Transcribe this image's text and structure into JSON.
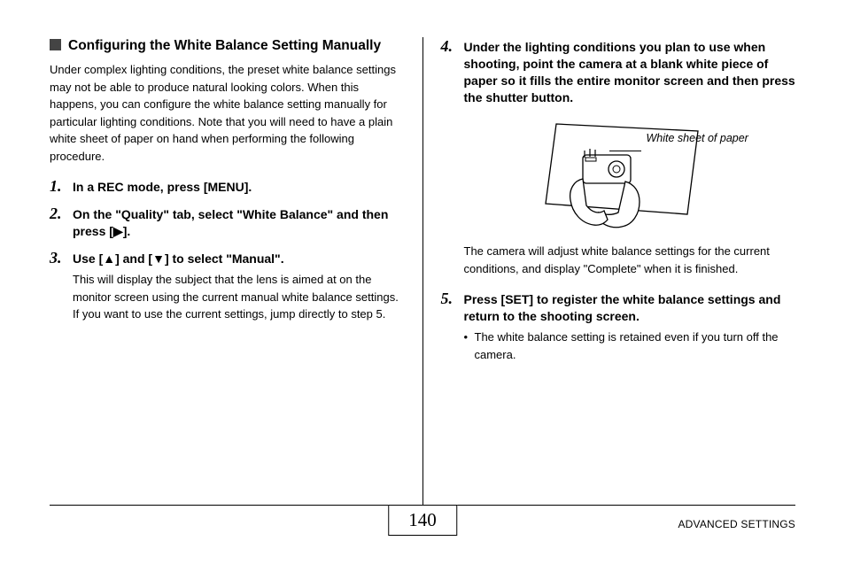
{
  "leftColumn": {
    "headingTitle": "Configuring the White Balance Setting Manually",
    "introText": "Under complex lighting conditions, the preset white balance settings may not be able to produce natural looking colors. When this happens, you can configure the white balance setting manually for particular lighting conditions. Note that you will need to have a plain white sheet of paper on hand when performing the following procedure.",
    "step1": {
      "num": "1.",
      "title": "In a REC mode, press [MENU]."
    },
    "step2": {
      "num": "2.",
      "titlePrefix": "On the \"Quality\" tab, select \"White Balance\" and then press [",
      "titleSuffix": "]."
    },
    "step3": {
      "num": "3.",
      "titlePrefix": "Use [",
      "titleMid": "] and [",
      "titleSuffix": "] to select \"Manual\".",
      "body": "This will display the subject that the lens is aimed at on the monitor screen using the current manual white balance settings. If you want to use the current settings, jump directly to step 5."
    }
  },
  "rightColumn": {
    "step4": {
      "num": "4.",
      "title": "Under the lighting conditions you plan to use when shooting, point the camera at a blank white piece of paper so it fills the entire monitor screen and then press the shutter button.",
      "afterText": "The camera will adjust white balance settings for the current conditions, and display \"Complete\" when it is finished."
    },
    "illustrationLabel": "White sheet of paper",
    "step5": {
      "num": "5.",
      "title": "Press [SET] to register the white balance settings and return to the shooting screen.",
      "bullet": "The white balance setting is retained even if you turn off the camera."
    }
  },
  "footer": {
    "pageNumber": "140",
    "sectionLabel": "ADVANCED SETTINGS"
  }
}
